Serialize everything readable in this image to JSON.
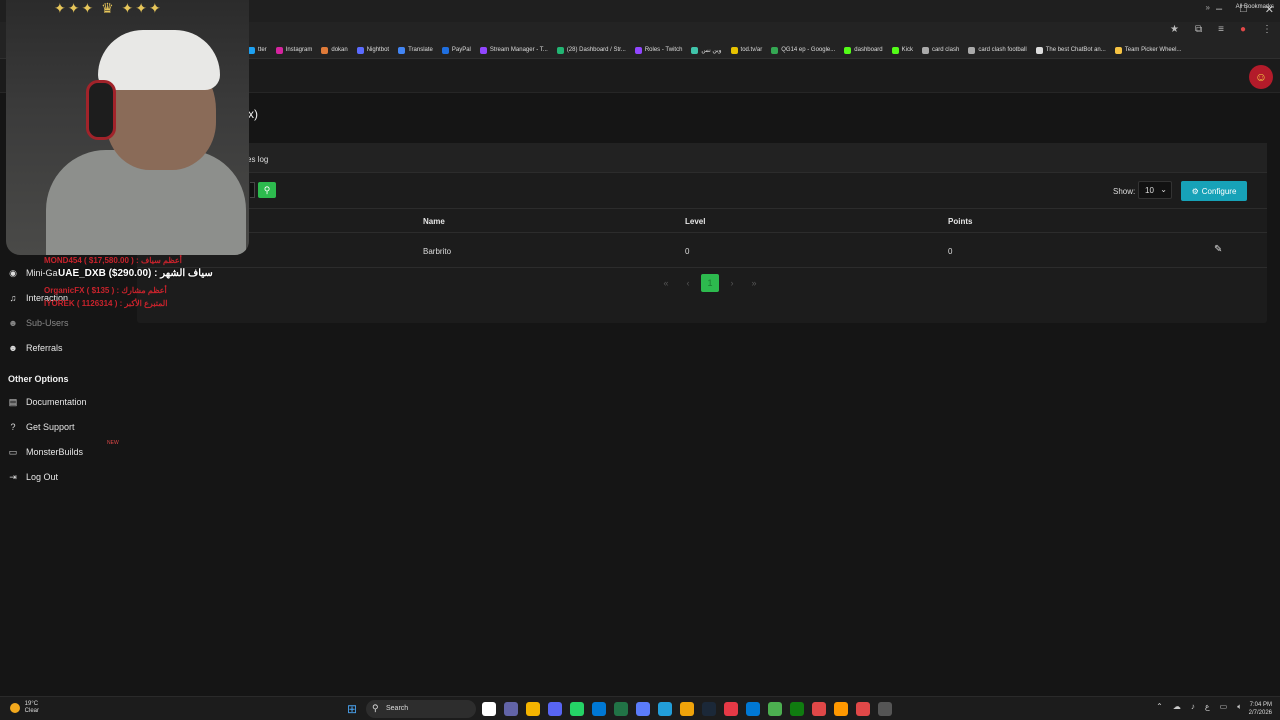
{
  "browser": {
    "window_controls": [
      "–",
      "□",
      "✕"
    ],
    "bookmarks": [
      {
        "label": "tter",
        "color": "#1da1f2"
      },
      {
        "label": "Instagram",
        "color": "#d6249f"
      },
      {
        "label": "dokan",
        "color": "#e07b39"
      },
      {
        "label": "Nightbot",
        "color": "#5b6bff"
      },
      {
        "label": "Translate",
        "color": "#4285f4"
      },
      {
        "label": "PayPal",
        "color": "#1f6fe0"
      },
      {
        "label": "Stream Manager - T...",
        "color": "#9146ff"
      },
      {
        "label": "(28) Dashboard / Str...",
        "color": "#22b573"
      },
      {
        "label": "Roles - Twitch",
        "color": "#9146ff"
      },
      {
        "label": "وين نس",
        "color": "#40c4aa"
      },
      {
        "label": "tod.tv/ar",
        "color": "#e6c200"
      },
      {
        "label": "QG14 ep - Google...",
        "color": "#34a853"
      },
      {
        "label": "dashboard",
        "color": "#53fc18"
      },
      {
        "label": "Kick",
        "color": "#53fc18"
      },
      {
        "label": "card clash",
        "color": "#aaaaaa"
      },
      {
        "label": "card clash football",
        "color": "#aaaaaa"
      },
      {
        "label": "The best ChatBot an...",
        "color": "#dddddd"
      },
      {
        "label": "Team Picker Wheel...",
        "color": "#f6c343"
      }
    ],
    "bookmarks_more": "»",
    "all_bookmarks": "All Bookmarks"
  },
  "page": {
    "title_fragment": "x)",
    "tab_fragment": "es log"
  },
  "sidebar": {
    "items": [
      {
        "label": "",
        "icon": "■"
      },
      {
        "label": "Mini-Ga",
        "icon": "◉"
      },
      {
        "label": "Interaction",
        "icon": "♫"
      },
      {
        "label": "Sub-Users",
        "icon": "☻"
      },
      {
        "label": "Referrals",
        "icon": "☻"
      }
    ],
    "section_title": "Other Options",
    "other": [
      {
        "label": "Documentation",
        "icon": "▤"
      },
      {
        "label": "Get Support",
        "icon": "?"
      },
      {
        "label": "MonsterBuilds",
        "icon": "▭"
      },
      {
        "label": "Log Out",
        "icon": "⇥"
      }
    ],
    "mb_badge": "NEW"
  },
  "toolbar": {
    "show_label": "Show:",
    "show_value": "10",
    "configure_label": "Configure"
  },
  "table": {
    "headers": [
      "Name",
      "Level",
      "Points"
    ],
    "rows": [
      {
        "name": "Barbrito",
        "level": "0",
        "points": "0"
      }
    ]
  },
  "pagination": {
    "first": "«",
    "prev": "‹",
    "current": "1",
    "next": "›",
    "last": "»"
  },
  "stream_overlay": {
    "line1": "MOND454 ( $17,580.00 ) : أعظم سياف",
    "line2": "UAE_DXB ($290.00) : سياف الشهر",
    "line3": "OrganicFX ( $135 ) : أعظم مشارك",
    "line4": "IYOREK ( 1126314 ) : المتبرع الأكبر"
  },
  "taskbar": {
    "temp": "19°C",
    "weather": "Clear",
    "search": "Search",
    "time": "7:04 PM",
    "date": "2/7/2026",
    "lang": "ع",
    "apps": [
      "#ffffff",
      "#6264a7",
      "#f4b400",
      "#5865f2",
      "#25d366",
      "#0078d4",
      "#217346",
      "#5b7cfa",
      "#229ed9",
      "#f0a30a",
      "#1b2838",
      "#e63946",
      "#0078d4",
      "#4caf50",
      "#107c10",
      "#e04848",
      "#ff9800",
      "#e04848",
      "#555555"
    ]
  }
}
